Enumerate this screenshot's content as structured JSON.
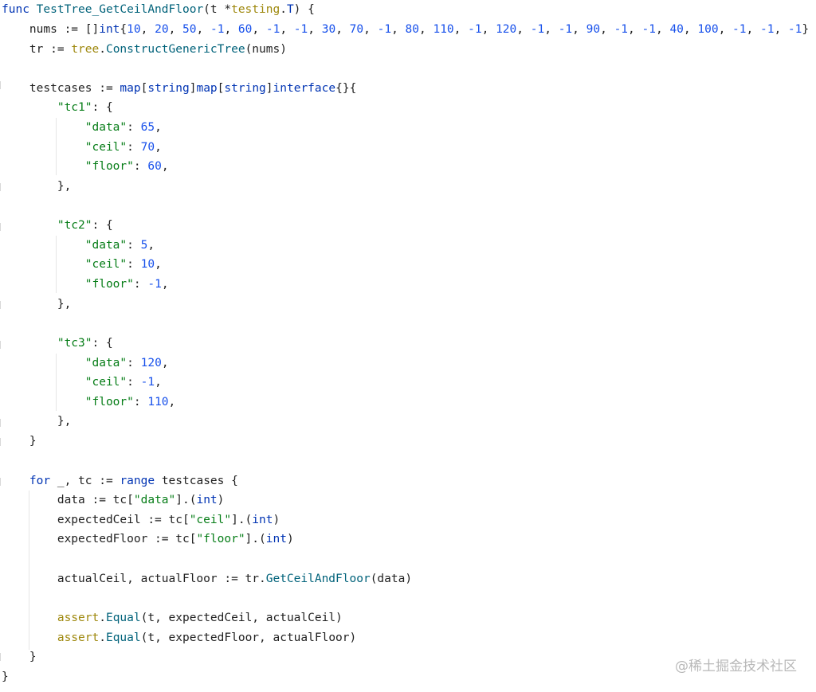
{
  "code": {
    "l01": [
      {
        "t": "func",
        "c": "kw"
      },
      {
        "t": " ",
        "c": "plain"
      },
      {
        "t": "TestTree_GetCeilAndFloor",
        "c": "fn"
      },
      {
        "t": "(t *",
        "c": "plain"
      },
      {
        "t": "testing",
        "c": "pkg"
      },
      {
        "t": ".",
        "c": "plain"
      },
      {
        "t": "T",
        "c": "kw"
      },
      {
        "t": ") {",
        "c": "plain"
      }
    ],
    "l02": [
      {
        "t": "    nums := []",
        "c": "plain"
      },
      {
        "t": "int",
        "c": "kw"
      },
      {
        "t": "{",
        "c": "plain"
      },
      {
        "t": "10",
        "c": "num"
      },
      {
        "t": ", ",
        "c": "plain"
      },
      {
        "t": "20",
        "c": "num"
      },
      {
        "t": ", ",
        "c": "plain"
      },
      {
        "t": "50",
        "c": "num"
      },
      {
        "t": ", ",
        "c": "plain"
      },
      {
        "t": "-1",
        "c": "num"
      },
      {
        "t": ", ",
        "c": "plain"
      },
      {
        "t": "60",
        "c": "num"
      },
      {
        "t": ", ",
        "c": "plain"
      },
      {
        "t": "-1",
        "c": "num"
      },
      {
        "t": ", ",
        "c": "plain"
      },
      {
        "t": "-1",
        "c": "num"
      },
      {
        "t": ", ",
        "c": "plain"
      },
      {
        "t": "30",
        "c": "num"
      },
      {
        "t": ", ",
        "c": "plain"
      },
      {
        "t": "70",
        "c": "num"
      },
      {
        "t": ", ",
        "c": "plain"
      },
      {
        "t": "-1",
        "c": "num"
      },
      {
        "t": ", ",
        "c": "plain"
      },
      {
        "t": "80",
        "c": "num"
      },
      {
        "t": ", ",
        "c": "plain"
      },
      {
        "t": "110",
        "c": "num"
      },
      {
        "t": ", ",
        "c": "plain"
      },
      {
        "t": "-1",
        "c": "num"
      },
      {
        "t": ", ",
        "c": "plain"
      },
      {
        "t": "120",
        "c": "num"
      },
      {
        "t": ", ",
        "c": "plain"
      },
      {
        "t": "-1",
        "c": "num"
      },
      {
        "t": ", ",
        "c": "plain"
      },
      {
        "t": "-1",
        "c": "num"
      },
      {
        "t": ", ",
        "c": "plain"
      },
      {
        "t": "90",
        "c": "num"
      },
      {
        "t": ", ",
        "c": "plain"
      },
      {
        "t": "-1",
        "c": "num"
      },
      {
        "t": ", ",
        "c": "plain"
      },
      {
        "t": "-1",
        "c": "num"
      },
      {
        "t": ", ",
        "c": "plain"
      },
      {
        "t": "40",
        "c": "num"
      },
      {
        "t": ", ",
        "c": "plain"
      },
      {
        "t": "100",
        "c": "num"
      },
      {
        "t": ", ",
        "c": "plain"
      },
      {
        "t": "-1",
        "c": "num"
      },
      {
        "t": ", ",
        "c": "plain"
      },
      {
        "t": "-1",
        "c": "num"
      },
      {
        "t": ", ",
        "c": "plain"
      },
      {
        "t": "-1",
        "c": "num"
      },
      {
        "t": "}",
        "c": "plain"
      }
    ],
    "l03": [
      {
        "t": "    tr := ",
        "c": "plain"
      },
      {
        "t": "tree",
        "c": "pkg"
      },
      {
        "t": ".",
        "c": "plain"
      },
      {
        "t": "ConstructGenericTree",
        "c": "fn"
      },
      {
        "t": "(nums)",
        "c": "plain"
      }
    ],
    "l05": [
      {
        "t": "    testcases := ",
        "c": "plain"
      },
      {
        "t": "map",
        "c": "kw"
      },
      {
        "t": "[",
        "c": "plain"
      },
      {
        "t": "string",
        "c": "kw"
      },
      {
        "t": "]",
        "c": "plain"
      },
      {
        "t": "map",
        "c": "kw"
      },
      {
        "t": "[",
        "c": "plain"
      },
      {
        "t": "string",
        "c": "kw"
      },
      {
        "t": "]",
        "c": "plain"
      },
      {
        "t": "interface",
        "c": "kw"
      },
      {
        "t": "{}{",
        "c": "plain"
      }
    ],
    "l06": [
      {
        "t": "        ",
        "c": "plain"
      },
      {
        "t": "\"tc1\"",
        "c": "str"
      },
      {
        "t": ": {",
        "c": "plain"
      }
    ],
    "l07": [
      {
        "t": "            ",
        "c": "plain"
      },
      {
        "t": "\"data\"",
        "c": "str"
      },
      {
        "t": ": ",
        "c": "plain"
      },
      {
        "t": "65",
        "c": "num"
      },
      {
        "t": ",",
        "c": "plain"
      }
    ],
    "l08": [
      {
        "t": "            ",
        "c": "plain"
      },
      {
        "t": "\"ceil\"",
        "c": "str"
      },
      {
        "t": ": ",
        "c": "plain"
      },
      {
        "t": "70",
        "c": "num"
      },
      {
        "t": ",",
        "c": "plain"
      }
    ],
    "l09": [
      {
        "t": "            ",
        "c": "plain"
      },
      {
        "t": "\"floor\"",
        "c": "str"
      },
      {
        "t": ": ",
        "c": "plain"
      },
      {
        "t": "60",
        "c": "num"
      },
      {
        "t": ",",
        "c": "plain"
      }
    ],
    "l10": [
      {
        "t": "        },",
        "c": "plain"
      }
    ],
    "l12": [
      {
        "t": "        ",
        "c": "plain"
      },
      {
        "t": "\"tc2\"",
        "c": "str"
      },
      {
        "t": ": {",
        "c": "plain"
      }
    ],
    "l13": [
      {
        "t": "            ",
        "c": "plain"
      },
      {
        "t": "\"data\"",
        "c": "str"
      },
      {
        "t": ": ",
        "c": "plain"
      },
      {
        "t": "5",
        "c": "num"
      },
      {
        "t": ",",
        "c": "plain"
      }
    ],
    "l14": [
      {
        "t": "            ",
        "c": "plain"
      },
      {
        "t": "\"ceil\"",
        "c": "str"
      },
      {
        "t": ": ",
        "c": "plain"
      },
      {
        "t": "10",
        "c": "num"
      },
      {
        "t": ",",
        "c": "plain"
      }
    ],
    "l15": [
      {
        "t": "            ",
        "c": "plain"
      },
      {
        "t": "\"floor\"",
        "c": "str"
      },
      {
        "t": ": ",
        "c": "plain"
      },
      {
        "t": "-1",
        "c": "num"
      },
      {
        "t": ",",
        "c": "plain"
      }
    ],
    "l16": [
      {
        "t": "        },",
        "c": "plain"
      }
    ],
    "l18": [
      {
        "t": "        ",
        "c": "plain"
      },
      {
        "t": "\"tc3\"",
        "c": "str"
      },
      {
        "t": ": {",
        "c": "plain"
      }
    ],
    "l19": [
      {
        "t": "            ",
        "c": "plain"
      },
      {
        "t": "\"data\"",
        "c": "str"
      },
      {
        "t": ": ",
        "c": "plain"
      },
      {
        "t": "120",
        "c": "num"
      },
      {
        "t": ",",
        "c": "plain"
      }
    ],
    "l20": [
      {
        "t": "            ",
        "c": "plain"
      },
      {
        "t": "\"ceil\"",
        "c": "str"
      },
      {
        "t": ": ",
        "c": "plain"
      },
      {
        "t": "-1",
        "c": "num"
      },
      {
        "t": ",",
        "c": "plain"
      }
    ],
    "l21": [
      {
        "t": "            ",
        "c": "plain"
      },
      {
        "t": "\"floor\"",
        "c": "str"
      },
      {
        "t": ": ",
        "c": "plain"
      },
      {
        "t": "110",
        "c": "num"
      },
      {
        "t": ",",
        "c": "plain"
      }
    ],
    "l22": [
      {
        "t": "        },",
        "c": "plain"
      }
    ],
    "l23": [
      {
        "t": "    }",
        "c": "plain"
      }
    ],
    "l25": [
      {
        "t": "    ",
        "c": "plain"
      },
      {
        "t": "for",
        "c": "kw"
      },
      {
        "t": " _, tc := ",
        "c": "plain"
      },
      {
        "t": "range",
        "c": "kw"
      },
      {
        "t": " testcases {",
        "c": "plain"
      }
    ],
    "l26": [
      {
        "t": "        data := tc[",
        "c": "plain"
      },
      {
        "t": "\"data\"",
        "c": "str"
      },
      {
        "t": "].(",
        "c": "plain"
      },
      {
        "t": "int",
        "c": "kw"
      },
      {
        "t": ")",
        "c": "plain"
      }
    ],
    "l27": [
      {
        "t": "        expectedCeil := tc[",
        "c": "plain"
      },
      {
        "t": "\"ceil\"",
        "c": "str"
      },
      {
        "t": "].(",
        "c": "plain"
      },
      {
        "t": "int",
        "c": "kw"
      },
      {
        "t": ")",
        "c": "plain"
      }
    ],
    "l28": [
      {
        "t": "        expectedFloor := tc[",
        "c": "plain"
      },
      {
        "t": "\"floor\"",
        "c": "str"
      },
      {
        "t": "].(",
        "c": "plain"
      },
      {
        "t": "int",
        "c": "kw"
      },
      {
        "t": ")",
        "c": "plain"
      }
    ],
    "l30": [
      {
        "t": "        actualCeil, actualFloor := tr.",
        "c": "plain"
      },
      {
        "t": "GetCeilAndFloor",
        "c": "fn"
      },
      {
        "t": "(data)",
        "c": "plain"
      }
    ],
    "l32": [
      {
        "t": "        ",
        "c": "plain"
      },
      {
        "t": "assert",
        "c": "pkg"
      },
      {
        "t": ".",
        "c": "plain"
      },
      {
        "t": "Equal",
        "c": "fn"
      },
      {
        "t": "(t, expectedCeil, actualCeil)",
        "c": "plain"
      }
    ],
    "l33": [
      {
        "t": "        ",
        "c": "plain"
      },
      {
        "t": "assert",
        "c": "pkg"
      },
      {
        "t": ".",
        "c": "plain"
      },
      {
        "t": "Equal",
        "c": "fn"
      },
      {
        "t": "(t, expectedFloor, actualFloor)",
        "c": "plain"
      }
    ],
    "l34": [
      {
        "t": "    }",
        "c": "plain"
      }
    ],
    "l35": [
      {
        "t": "}",
        "c": "plain"
      }
    ]
  },
  "watermark": "@稀土掘金技术社区",
  "colors": {
    "keyword": "#0033b3",
    "function": "#00627a",
    "number": "#1750eb",
    "string": "#067d17",
    "package": "#9e880d",
    "text": "#1f1f1f"
  }
}
